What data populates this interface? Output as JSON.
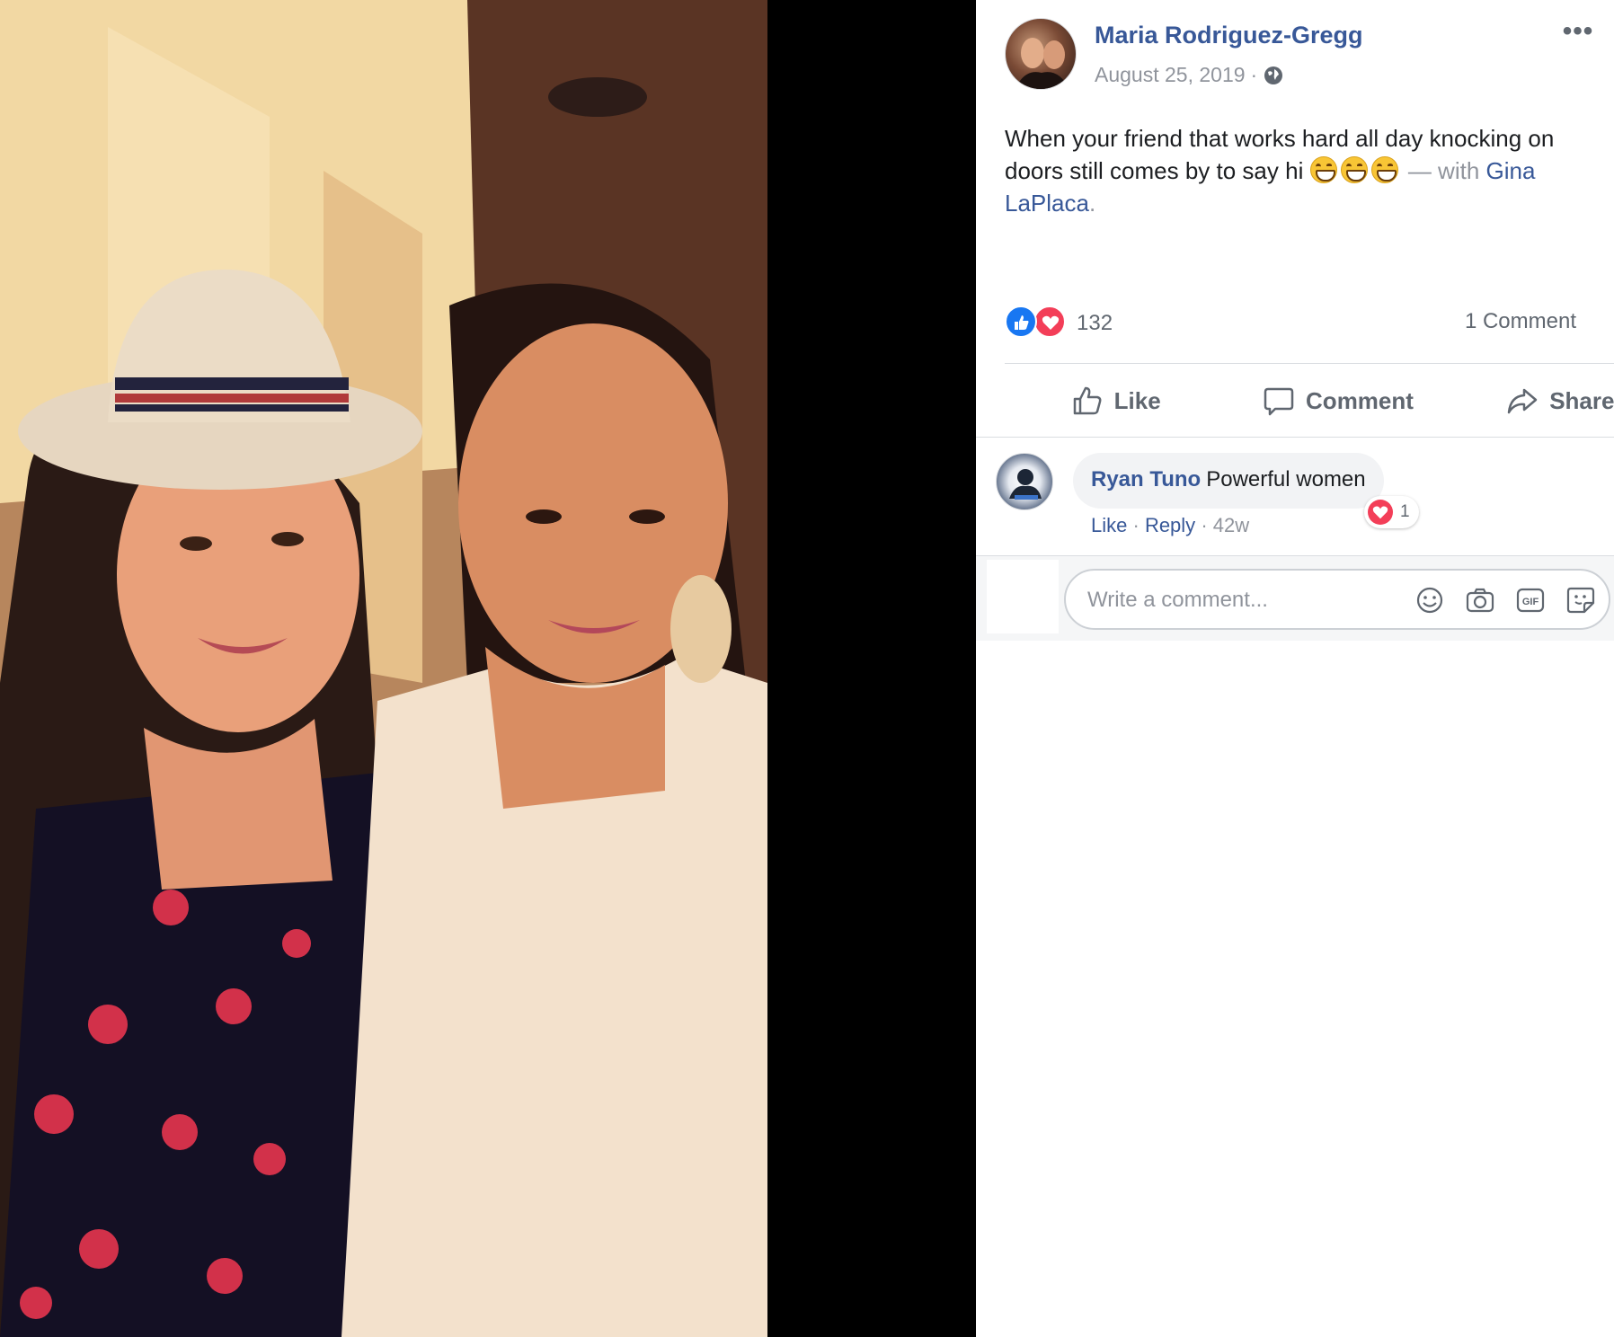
{
  "post": {
    "author_name": "Maria Rodriguez-Gregg",
    "date": "August 25, 2019",
    "date_separator": "·",
    "privacy_icon": "globe-icon",
    "more_label": "•••",
    "text_main": "When your friend that works hard all day knocking on doors still comes by to say hi",
    "text_with": "— with",
    "tagged_person": "Gina LaPlaca",
    "text_end": "."
  },
  "reactions": {
    "count": "132",
    "icons": [
      "like-icon",
      "love-icon"
    ],
    "comments_label": "1 Comment"
  },
  "actions": {
    "like": "Like",
    "comment": "Comment",
    "share": "Share"
  },
  "comment": {
    "author": "Ryan Tuno",
    "text": "Powerful women",
    "like": "Like",
    "reply": "Reply",
    "age": "42w",
    "separator": "·",
    "reaction_count": "1"
  },
  "composer": {
    "placeholder": "Write a comment...",
    "icons": [
      "emoji-icon",
      "camera-icon",
      "gif-icon",
      "sticker-icon"
    ],
    "gif_label": "GIF"
  },
  "colors": {
    "link": "#385898",
    "like_blue": "#1877f2",
    "love_red": "#f33e58",
    "muted": "#90949c"
  }
}
